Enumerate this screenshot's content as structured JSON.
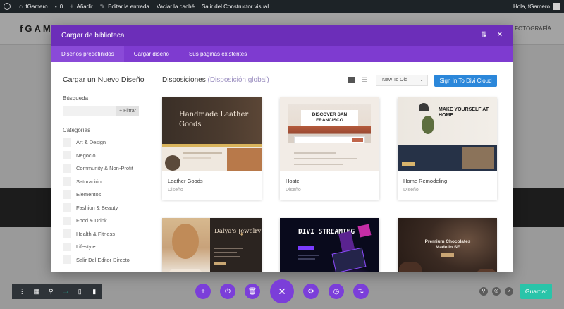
{
  "adminbar": {
    "site_name": "fGamero",
    "comments_count": "0",
    "new_label": "Añadir",
    "edit_label": "Editar la entrada",
    "cache_label": "Vaciar la caché",
    "exit_label": "Salir del Constructor visual",
    "greeting": "Hola, fGamero"
  },
  "site": {
    "logo": "fGAM",
    "nav_item": "FOTOGRAFÍA"
  },
  "modal": {
    "title": "Cargar de biblioteca",
    "tabs": [
      {
        "label": "Diseños predefinidos",
        "active": true
      },
      {
        "label": "Cargar diseño",
        "active": false
      },
      {
        "label": "Sus páginas existentes",
        "active": false
      }
    ],
    "sidebar": {
      "title": "Cargar un Nuevo Diseño",
      "search_label": "Búsqueda",
      "filter_label": "+ Filtrar",
      "categories_label": "Categorías",
      "categories": [
        "Art & Design",
        "Negocio",
        "Community & Non-Profit",
        "Saturación",
        "Elementos",
        "Fashion & Beauty",
        "Food & Drink",
        "Health & Fitness",
        "Lifestyle",
        "Salir Del Editor Directo"
      ]
    },
    "main": {
      "title": "Disposiciones",
      "subtitle": "(Disposición global)",
      "sort_value": "New To Old",
      "cloud_button": "Sign In To Divi Cloud",
      "layouts": [
        {
          "name": "Leather Goods",
          "kind": "Diseño",
          "thumb_text": "Handmade Leather Goods"
        },
        {
          "name": "Hostel",
          "kind": "Diseño",
          "thumb_text": "DISCOVER SAN FRANCISCO"
        },
        {
          "name": "Home Remodeling",
          "kind": "Diseño",
          "thumb_text": "MAKE YOURSELF AT HOME"
        },
        {
          "name": "",
          "kind": "",
          "thumb_text": "Dalya's Jewelry"
        },
        {
          "name": "",
          "kind": "",
          "thumb_text": "DIVI STREAMING"
        },
        {
          "name": "",
          "kind": "",
          "thumb_text": "Premium Chocolates Made in SF"
        }
      ]
    }
  },
  "bottom_bar": {
    "save_label": "Guardar"
  },
  "colors": {
    "header_purple": "#6c2eb9",
    "tabs_purple": "#7e3bd0",
    "cloud_blue": "#2b87da",
    "save_green": "#29c4a9",
    "builder_dark": "#2e3338"
  }
}
